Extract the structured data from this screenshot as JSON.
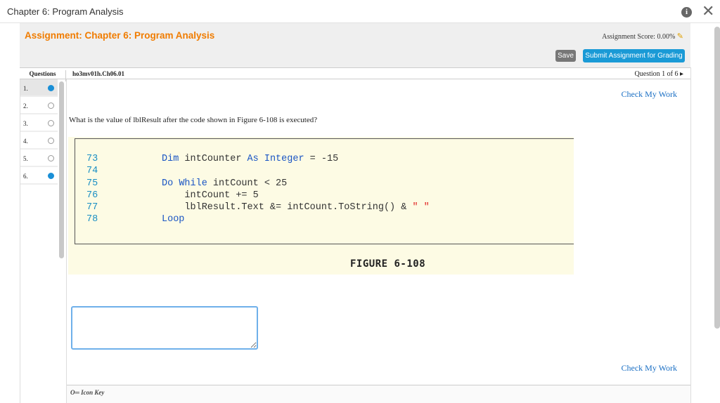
{
  "window": {
    "title": "Chapter 6: Program Analysis"
  },
  "header": {
    "assignment_title": "Assignment: Chapter 6: Program Analysis",
    "score": "Assignment Score: 0.00%",
    "save": "Save",
    "submit": "Submit Assignment for Grading"
  },
  "qbar": {
    "questions_label": "Questions",
    "question_id": "ho3mv01h.Ch06.01",
    "position": "Question 1 of 6 ▸"
  },
  "questions": [
    {
      "n": "1.",
      "done": true
    },
    {
      "n": "2.",
      "done": false
    },
    {
      "n": "3.",
      "done": false
    },
    {
      "n": "4.",
      "done": false
    },
    {
      "n": "5.",
      "done": false
    },
    {
      "n": "6.",
      "done": true
    }
  ],
  "main": {
    "check_top": "Check My Work",
    "check_bottom": "Check My Work",
    "prompt": "What is the value of lblResult after the code shown in Figure 6-108 is executed?",
    "answer_value": "",
    "figure_label": "FIGURE 6-108",
    "icon_key": "Icon Key"
  },
  "code": {
    "l73": {
      "n": "73",
      "a": "Dim",
      "b": " intCounter ",
      "c": "As",
      "d": " ",
      "e": "Integer",
      "f": " = -15"
    },
    "l74": {
      "n": "74"
    },
    "l75": {
      "n": "75",
      "a": "Do",
      "b": " ",
      "c": "While",
      "d": " intCount < 25"
    },
    "l76": {
      "n": "76",
      "a": "    intCount += 5"
    },
    "l77": {
      "n": "77",
      "a": "    lblResult.Text &= intCount.ToString() & ",
      "b": "\" \""
    },
    "l78": {
      "n": "78",
      "a": "Loop"
    }
  },
  "colors": {
    "accent": "#f07c00",
    "button": "#1a9ad6",
    "link": "#1a6fc4",
    "figure_bg": "#fdfbe4"
  }
}
